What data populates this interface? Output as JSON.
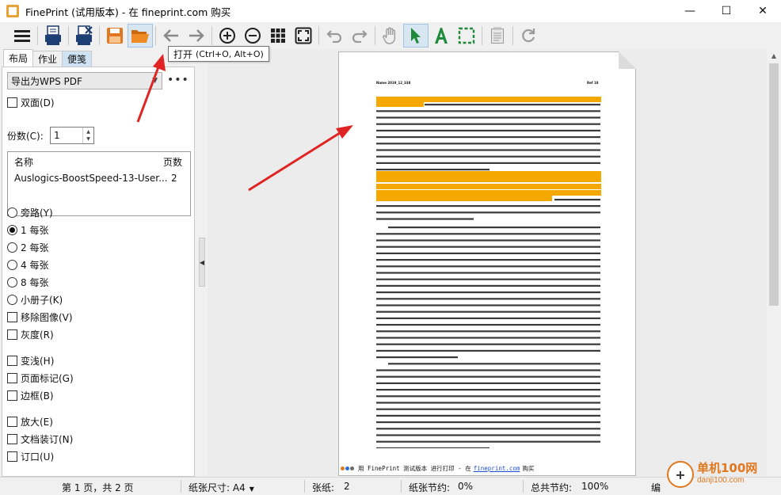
{
  "window": {
    "title": "FinePrint (试用版本) - 在 fineprint.com 购买",
    "minimize_icon": "—",
    "maximize_icon": "☐",
    "close_icon": "✕"
  },
  "toolbar": {
    "tooltip_main": "打开",
    "tooltip_shortcut": "(Ctrl+O, Alt+O)"
  },
  "left": {
    "tabs": [
      "布局",
      "作业",
      "便笺"
    ],
    "printer_select": "导出为WPS PDF",
    "more_button": "•••",
    "duplex_label": "双面(D)",
    "copies_label": "份数(C):",
    "copies_value": "1",
    "joblist": {
      "col_name": "名称",
      "col_pages": "页数",
      "row_name": "Auslogics-BoostSpeed-13-User...",
      "row_pages": "2"
    },
    "layout_options": [
      {
        "label": "旁路(Y)",
        "checked": false
      },
      {
        "label": "1 每张",
        "checked": true
      },
      {
        "label": "2 每张",
        "checked": false
      },
      {
        "label": "4 每张",
        "checked": false
      },
      {
        "label": "8 每张",
        "checked": false
      },
      {
        "label": "小册子(K)",
        "checked": false
      }
    ],
    "checkboxes_a": [
      "移除图像(V)",
      "灰度(R)"
    ],
    "checkboxes_b": [
      "变浅(H)",
      "页面标记(G)",
      "边框(B)"
    ],
    "checkboxes_c": [
      "放大(E)",
      "文档装订(N)",
      "订口(U)"
    ]
  },
  "page_preview": {
    "header_left": "Name 2019_12_338",
    "header_right": "Ref 18",
    "footer_prefix": "用 FinePrint 测试版本 进行打印 - 在",
    "footer_link": "fineprint.com",
    "footer_suffix": "购买",
    "footer_dot_colors": [
      "#e07820",
      "#2a6fd6",
      "#6a6a6a"
    ]
  },
  "statusbar": {
    "page_info": "第 1 页，共 2 页",
    "paper_size": "纸张尺寸: A4",
    "sheets_label": "张纸:",
    "sheets_value": "2",
    "paper_saved_label": "纸张节约:",
    "paper_saved_value": "0%",
    "total_saved_label": "总共节约:",
    "total_saved_value": "100%",
    "extra": "编"
  },
  "watermark": {
    "logo_symbol": "+",
    "name": "单机100网",
    "url": "danji100.com"
  },
  "colors": {
    "highlight": "#f5a800",
    "arrow": "#e02424",
    "tab_highlight": "#cfe3f5"
  }
}
